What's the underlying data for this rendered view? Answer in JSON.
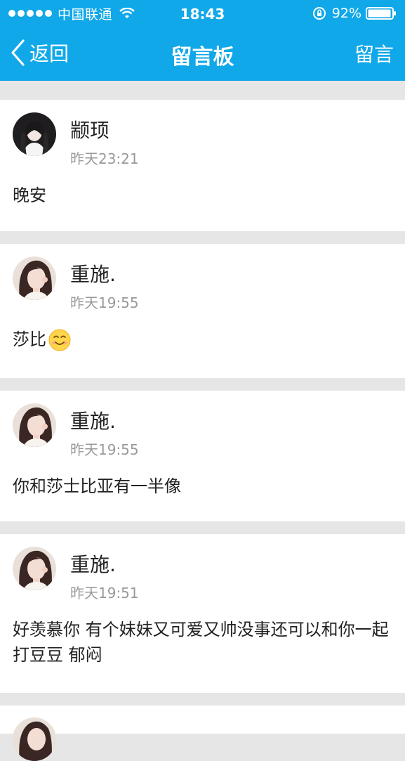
{
  "status_bar": {
    "carrier": "中国联通",
    "time": "18:43",
    "battery": "92%",
    "icons": [
      "signal-dots-icon",
      "wifi-icon",
      "rotation-lock-icon",
      "battery-icon"
    ]
  },
  "nav": {
    "back_label": "返回",
    "title": "留言板",
    "action_label": "留言"
  },
  "colors": {
    "header_bg": "#10a8e8",
    "page_bg": "#e6e6e6",
    "card_bg": "#ffffff",
    "meta_text": "#999999"
  },
  "messages": [
    {
      "author": "颛顼",
      "time": "昨天23:21",
      "text": "晚安",
      "avatar": "avatar-dark-icon"
    },
    {
      "author": "重施.",
      "time": "昨天19:55",
      "text": "莎比",
      "emoji": "smiling-face-icon",
      "avatar": "avatar-selfie-icon"
    },
    {
      "author": "重施.",
      "time": "昨天19:55",
      "text": "你和莎士比亚有一半像",
      "avatar": "avatar-selfie-icon"
    },
    {
      "author": "重施.",
      "time": "昨天19:51",
      "text": "好羡慕你 有个妹妹又可爱又帅没事还可以和你一起打豆豆 郁闷",
      "avatar": "avatar-selfie-icon"
    }
  ]
}
